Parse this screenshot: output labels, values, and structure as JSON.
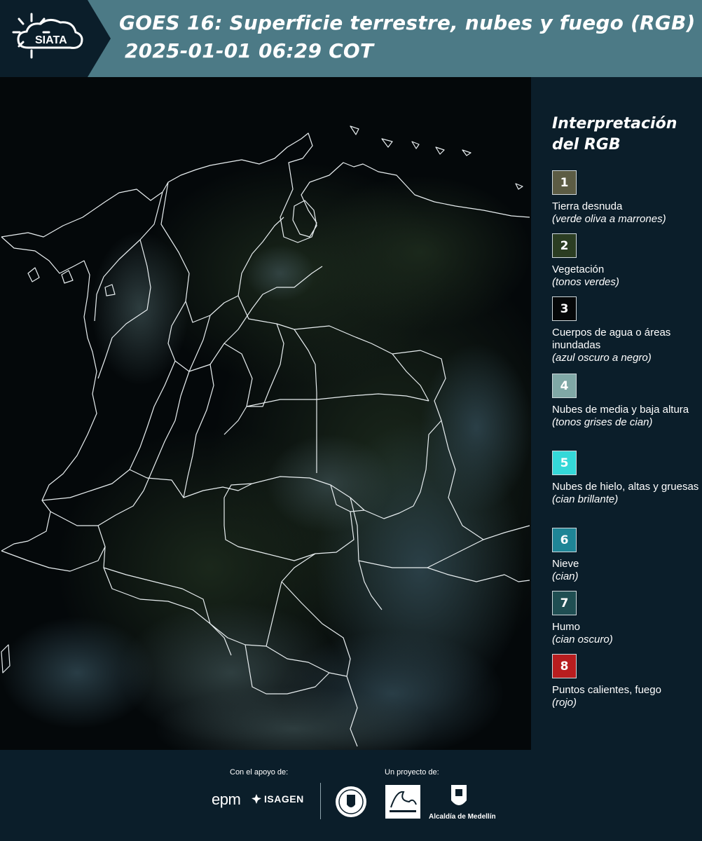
{
  "header": {
    "logo_text": "SIATA",
    "title_line1": "GOES 16: Superficie terrestre, nubes y fuego (RGB)",
    "title_line2": "2025-01-01 06:29 COT",
    "bg_color": "#4c7a86",
    "logo_bg_color": "#0b1e2a"
  },
  "legend": {
    "title": "Interpretación del RGB",
    "items": [
      {
        "number": "1",
        "label": "Tierra desnuda",
        "desc": "(verde oliva a marrones)",
        "color": "#5c5c44"
      },
      {
        "number": "2",
        "label": "Vegetación",
        "desc": "(tonos verdes)",
        "color": "#2b3d22"
      },
      {
        "number": "3",
        "label": "Cuerpos de agua o áreas inundadas",
        "desc": "(azul oscuro a negro)",
        "color": "#050708"
      },
      {
        "number": "4",
        "label": "Nubes de media y baja altura",
        "desc": "(tonos grises de cian)",
        "color": "#80a8a6"
      },
      {
        "number": "5",
        "label": "Nubes de hielo, altas y gruesas",
        "desc": "(cian brillante)",
        "color": "#34d8d8"
      },
      {
        "number": "6",
        "label": "Nieve",
        "desc": "(cian)",
        "color": "#1f8596"
      },
      {
        "number": "7",
        "label": "Humo",
        "desc": "(cian oscuro)",
        "color": "#1f4e52"
      },
      {
        "number": "8",
        "label": "Puntos calientes, fuego",
        "desc": "(rojo)",
        "color": "#b81d1f"
      }
    ]
  },
  "footer": {
    "support_caption": "Con el apoyo de:",
    "project_caption": "Un proyecto de:",
    "epm_label": "epm",
    "isagen_label": "ISAGEN",
    "alcaldia_label": "Alcaldía de Medellín"
  }
}
